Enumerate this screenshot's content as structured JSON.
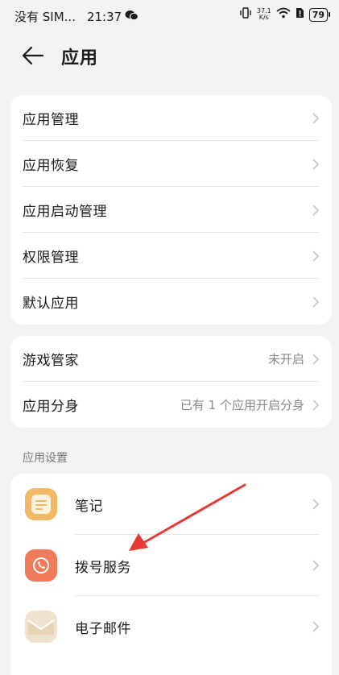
{
  "status_bar": {
    "carrier": "没有 SIM...",
    "time": "21:37",
    "net_speed_top": "37.1",
    "net_speed_bottom": "K/s",
    "battery": "79"
  },
  "header": {
    "title": "应用"
  },
  "group1": [
    {
      "label": "应用管理"
    },
    {
      "label": "应用恢复"
    },
    {
      "label": "应用启动管理"
    },
    {
      "label": "权限管理"
    },
    {
      "label": "默认应用"
    }
  ],
  "group2": [
    {
      "label": "游戏管家",
      "value": "未开启"
    },
    {
      "label": "应用分身",
      "value": "已有 1 个应用开启分身"
    }
  ],
  "app_settings": {
    "section_title": "应用设置",
    "apps": [
      {
        "label": "笔记",
        "icon": "notes-icon",
        "color": "#f2b865"
      },
      {
        "label": "拨号服务",
        "icon": "phone-icon",
        "color": "#f07a5a"
      },
      {
        "label": "电子邮件",
        "icon": "mail-icon",
        "color": "#efe3cf"
      }
    ]
  },
  "annotation": {
    "arrow_color": "#e53935"
  }
}
